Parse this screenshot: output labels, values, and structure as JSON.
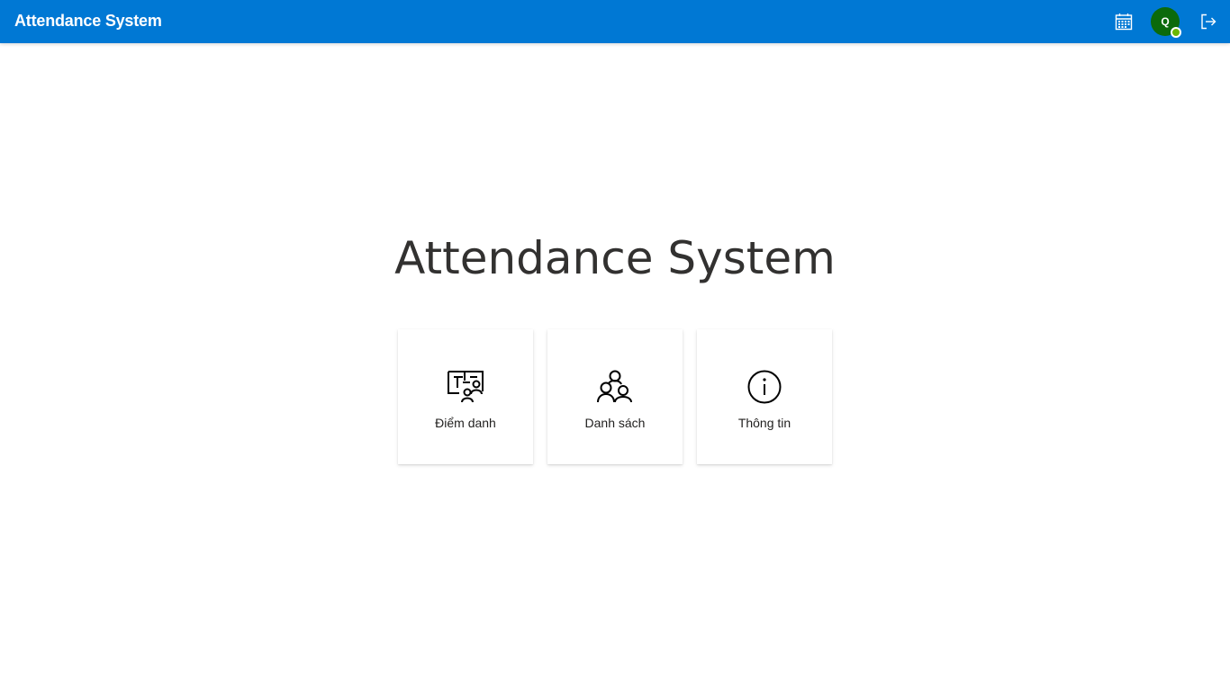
{
  "header": {
    "title": "Attendance System",
    "avatar_initial": "Q",
    "icons": {
      "calendar": "calendar-icon",
      "signout": "sign-out-icon"
    },
    "colors": {
      "bar": "#0078d4",
      "avatar": "#0b6a0b",
      "presence": "#6bb700"
    }
  },
  "main": {
    "title": "Attendance System",
    "cards": [
      {
        "label": "Điểm danh",
        "icon": "classroom-icon"
      },
      {
        "label": "Danh sách",
        "icon": "people-group-icon"
      },
      {
        "label": "Thông tin",
        "icon": "info-icon"
      }
    ]
  }
}
